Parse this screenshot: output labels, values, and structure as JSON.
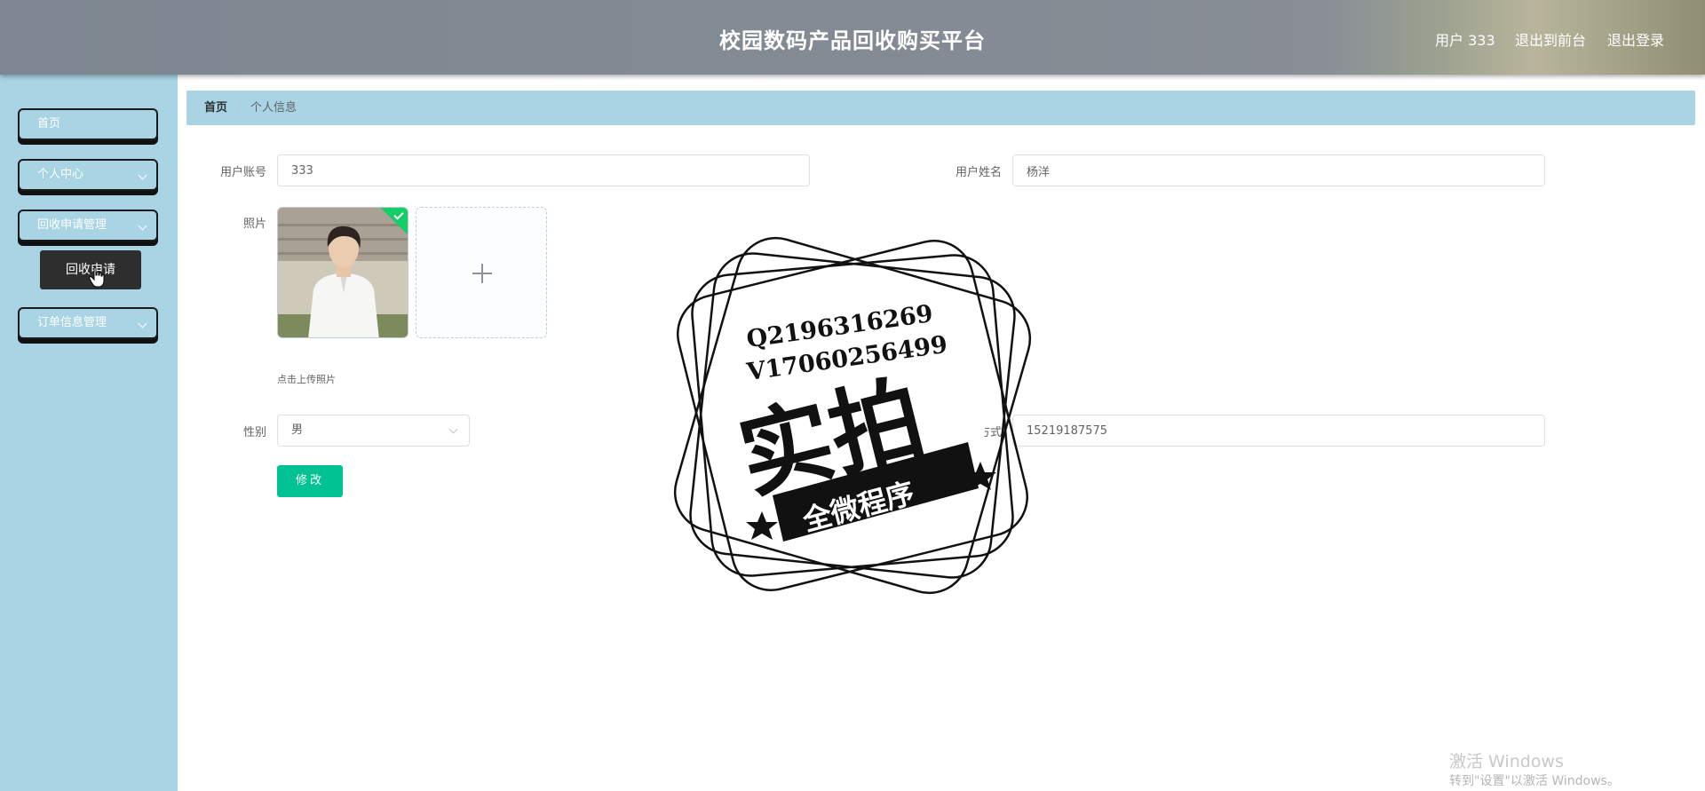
{
  "header": {
    "title": "校园数码产品回收购买平台",
    "user_label": "用户 333",
    "to_front_label": "退出到前台",
    "logout_label": "退出登录"
  },
  "sidebar": {
    "items": [
      {
        "label": "首页"
      },
      {
        "label": "个人中心"
      },
      {
        "label": "回收申请管理"
      },
      {
        "label": "订单信息管理"
      }
    ],
    "submenu_item": "回收申请"
  },
  "breadcrumb": {
    "home": "首页",
    "separator": "/",
    "current": "个人信息"
  },
  "form": {
    "account_label": "用户账号",
    "account_value": "333",
    "name_label": "用户姓名",
    "name_value": "杨洋",
    "photo_label": "照片",
    "upload_tip": "点击上传照片",
    "gender_label": "性别",
    "gender_value": "男",
    "contact_label": "联系方式",
    "contact_value": "15219187575",
    "submit_label": "修改"
  },
  "watermark": {
    "line1": "Q2196316269",
    "line2": "V17060256499",
    "big_text": "实拍",
    "ribbon_text": "全微程序"
  },
  "windows_activation": {
    "line1": "激活 Windows",
    "line2": "转到\"设置\"以激活 Windows。"
  },
  "colors": {
    "header_bg": "#848b94",
    "sidebar_bg": "#a9d4e4",
    "primary_button": "#00c292",
    "upload_success": "#13ce66"
  }
}
